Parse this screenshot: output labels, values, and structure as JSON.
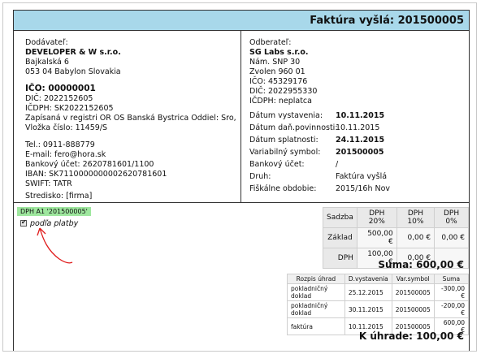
{
  "invoice": {
    "title": "Faktúra vyšlá: 201500005"
  },
  "supplier": {
    "heading": "Dodávateľ:",
    "name": "DEVELOPER & W s.r.o.",
    "street": "Bajkalská 6",
    "city": "053 04 Babylon Slovakia",
    "ico": "IČO: 00000001",
    "dic": "DIČ: 2022152605",
    "icdph": "IČDPH: SK2022152605",
    "register_1": "Zapísaná v registri OR OS Banská Bystrica Oddiel: Sro,",
    "register_2": "Vložka číslo: 11459/S",
    "tel": "Tel.: 0911-888779",
    "email": "E-mail: fero@hora.sk",
    "bank": "Bankový účet: 2620781601/1100",
    "iban": "IBAN: SK7110000000002620781601",
    "swift": "SWIFT: TATR",
    "center": "Stredisko: [firma]"
  },
  "customer": {
    "heading": "Odberateľ:",
    "name": "SG Labs s.r.o.",
    "street": "Nám. SNP 30",
    "city": "Zvolen 960 01",
    "ico": "IČO: 45329176",
    "dic": "DIČ: 2022955330",
    "icdph": "IČDPH: neplatca",
    "details": [
      {
        "label": "Dátum vystavenia:",
        "value": "10.11.2015",
        "bold": true
      },
      {
        "label": "Dátum daň.povinnosti:",
        "value": "10.11.2015",
        "bold": false
      },
      {
        "label": "Dátum splatnosti:",
        "value": "24.11.2015",
        "bold": true
      },
      {
        "label": "Variabilný symbol:",
        "value": "201500005",
        "bold": true
      },
      {
        "label": "Bankový účet:",
        "value": "/",
        "bold": false
      },
      {
        "label": "Druh:",
        "value": "Faktúra vyšlá",
        "bold": false
      },
      {
        "label": "Fiškálne obdobie:",
        "value": "2015/16h Nov",
        "bold": false
      }
    ]
  },
  "vat": {
    "badge": "DPH A1 '201500005'",
    "checkbox_label": "podľa platby",
    "checkbox_checked": true,
    "table": {
      "headers": [
        "Sadzba",
        "DPH 20%",
        "DPH 10%",
        "DPH 0%"
      ],
      "rows": [
        [
          "Základ",
          "500,00 €",
          "0,00 €",
          "0,00 €"
        ],
        [
          "DPH",
          "100,00 €",
          "0,00 €",
          ""
        ]
      ]
    }
  },
  "totals": {
    "suma": "Suma: 600,00 €",
    "k_uhrade": "K úhrade: 100,00 €"
  },
  "payments": {
    "headers": [
      "Rozpis úhrad",
      "D.vystavenia",
      "Var.symbol",
      "Suma"
    ],
    "rows": [
      [
        "pokladničný doklad",
        "25.12.2015",
        "201500005",
        "-300,00 €"
      ],
      [
        "pokladničný doklad",
        "30.11.2015",
        "201500005",
        "-200,00 €"
      ],
      [
        "faktúra",
        "10.11.2015",
        "201500005",
        "600,00 €"
      ]
    ]
  },
  "colors": {
    "title_bg": "#a8d8ea",
    "badge_bg": "#9ee79e",
    "arrow": "#e01b1b"
  }
}
